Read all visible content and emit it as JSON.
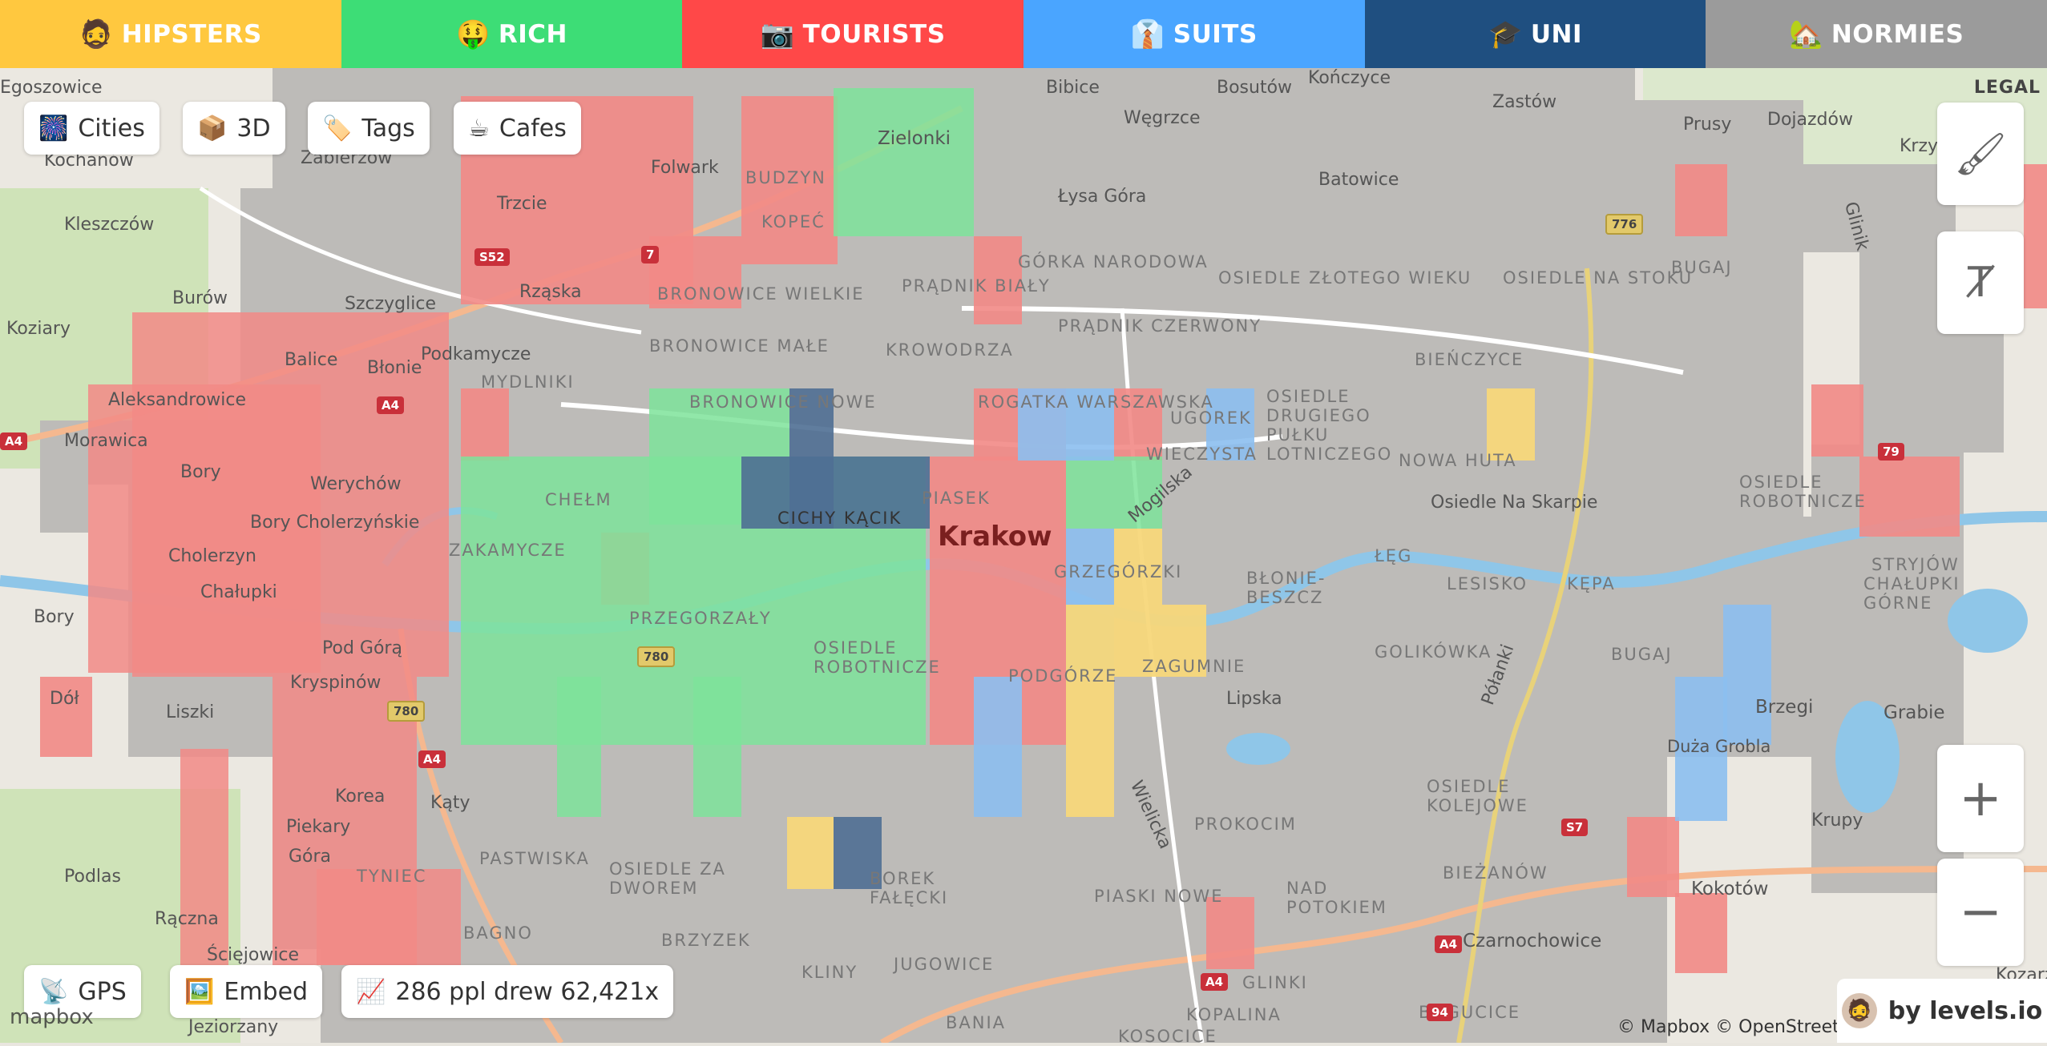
{
  "categories": [
    {
      "emoji": "🧔",
      "label": "HIPSTERS",
      "color": "#ffc83f"
    },
    {
      "emoji": "🤑",
      "label": "RICH",
      "color": "#3ddd76"
    },
    {
      "emoji": "📷",
      "label": "TOURISTS",
      "color": "#ff4848"
    },
    {
      "emoji": "👔",
      "label": "SUITS",
      "color": "#4aa5ff"
    },
    {
      "emoji": "🎓",
      "label": "UNI",
      "color": "#1f4f80"
    },
    {
      "emoji": "🏡",
      "label": "NORMIES",
      "color": "#9b9b9b"
    }
  ],
  "top_left_pills": [
    {
      "emoji": "🎆",
      "label": "Cities"
    },
    {
      "emoji": "📦",
      "label": "3D"
    },
    {
      "emoji": "🏷️",
      "label": "Tags"
    },
    {
      "emoji": "☕",
      "label": "Cafes"
    }
  ],
  "bottom_left_pills": [
    {
      "emoji": "📡",
      "label": "GPS"
    },
    {
      "emoji": "🖼️",
      "label": "Embed"
    },
    {
      "emoji": "📈",
      "label": "286 ppl drew 62,421x"
    }
  ],
  "side_buttons": {
    "brush": "🖌",
    "text": "Ⱦ",
    "zoom_in": "+",
    "zoom_out": "−"
  },
  "legal": "LEGAL",
  "attribution": "© Mapbox © OpenStreetMap",
  "credit": "by levels.io",
  "mapbox_logo": "mapbox",
  "map": {
    "city_label": "Krakow",
    "districts": [
      "Zielonki",
      "Budzyn",
      "Kopeć",
      "Prądnik Biały",
      "Górka Narodowa",
      "Osiedle Złotego Wieku",
      "Osiedle Na Stoku",
      "Bugaj",
      "Bronowice Wielkie",
      "Bronowice Małe",
      "Krowodrza",
      "Prądnik Czerwony",
      "Bieńczyce",
      "Mydlniki",
      "Bronowice Nowe",
      "Rogatka Warszawska",
      "Ugorek",
      "Osiedle Drugiego Pułku Lotniczego",
      "Wieczysta",
      "Nowa Huta",
      "Osiedle Robotnicze",
      "Chełm",
      "Cichy Kącik",
      "Piasek",
      "Zakamycze",
      "Grzegórzki",
      "Błonie-Beszcz",
      "Łęg",
      "Lesisko",
      "Kępa",
      "Chałupki Górne",
      "Przegorzały",
      "Osiedle Robotnicze",
      "Podgórze",
      "Zagumnie",
      "Golikówka",
      "Bugaj",
      "Stryjów",
      "Tyniec",
      "Pastwiska",
      "Osiedle za Dworem",
      "Borek Fałęcki",
      "Prokocim",
      "Osiedle Kolejowe",
      "Bagno",
      "Brzyzek",
      "Piaski Nowe",
      "Nad Potokiem",
      "Bieżanów",
      "Jugowice",
      "Kliny",
      "Glinki",
      "Bania",
      "Kopalina",
      "Bogucice",
      "Kosocice",
      "Czarnochowice",
      "Kokotów",
      "Krupy",
      "Grabie",
      "Brzegi",
      "Duża Grobla"
    ],
    "places": [
      "Bibice",
      "Bosutów",
      "Kończyce",
      "Zastów",
      "Węgrzce",
      "Prusy",
      "Dojazdów",
      "Krzyszto",
      "Egoszowice",
      "Kochanów",
      "Zabierzów",
      "Folwark",
      "Trzcie",
      "Rząska",
      "Kleszczów",
      "Burów",
      "Szczyglice",
      "Koziary",
      "Balice",
      "Podkamycze",
      "Błonie",
      "Aleksandrowice",
      "Morawica",
      "Bory",
      "Werychów",
      "Bory Cholerzyńskie",
      "Cholerzyn",
      "Chałupki",
      "Bory",
      "Pod Górą",
      "Kryspinów",
      "Dół",
      "Liszki",
      "Korea",
      "Kąty",
      "Piekary",
      "Góra",
      "Podlas",
      "Rączna",
      "Ścięjowice",
      "Jeziorzany",
      "Łysa Góra",
      "Batowice",
      "Osiedle Na Skarpie",
      "Mogilska",
      "Lipska",
      "Wielicka",
      "Półanki",
      "Glinik",
      "Kozarz"
    ],
    "roads": [
      {
        "label": "S52",
        "type": "red"
      },
      {
        "label": "7",
        "type": "red"
      },
      {
        "label": "A4",
        "type": "red"
      },
      {
        "label": "780",
        "type": "yellow"
      },
      {
        "label": "776",
        "type": "yellow"
      },
      {
        "label": "79",
        "type": "red"
      },
      {
        "label": "S7",
        "type": "red"
      },
      {
        "label": "94",
        "type": "red"
      }
    ]
  }
}
